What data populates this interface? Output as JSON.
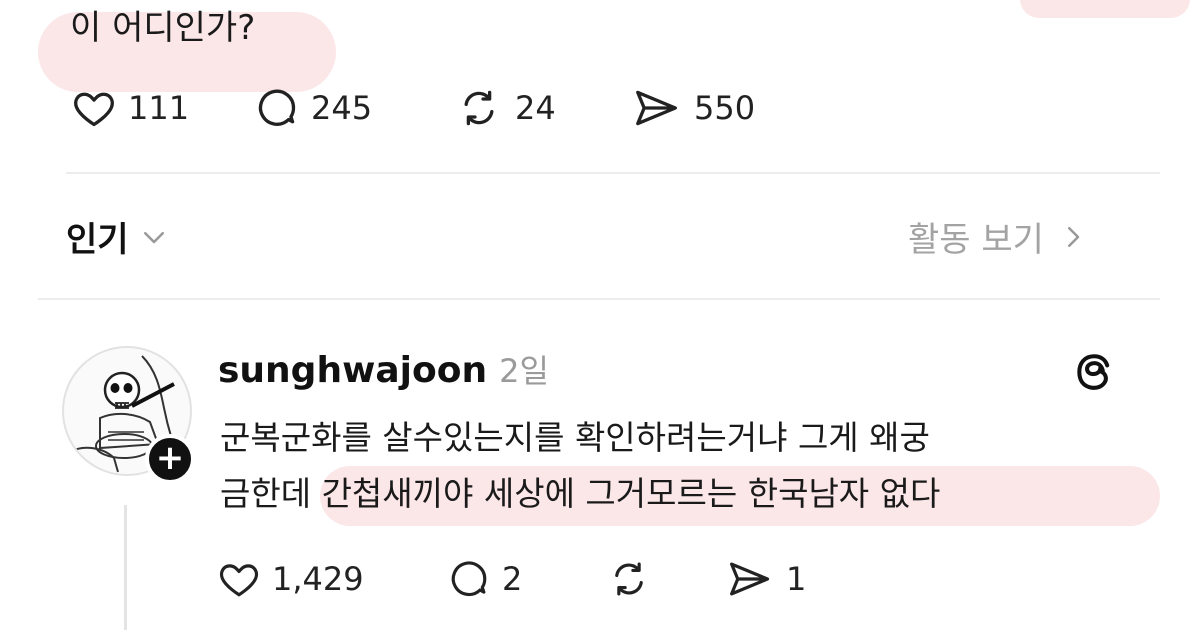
{
  "post": {
    "text_fragment": "이 어디인가?",
    "likes": "111",
    "replies": "245",
    "reposts": "24",
    "shares": "550"
  },
  "sort_bar": {
    "sort_label": "인기",
    "activity_label": "활동 보기"
  },
  "comment": {
    "username": "sunghwajoon",
    "time": "2일",
    "text_line1": "군복군화를 살수있는지를 확인하려는거냐  그게 왜궁",
    "text_line2": "금한데 간첩새끼야 세상에 그거모르는 한국남자 없다",
    "likes": "1,429",
    "replies": "2",
    "reposts": "",
    "shares": "1",
    "add_label": "+"
  },
  "colors": {
    "highlight": "#fbe3e6",
    "text": "#111111",
    "muted": "#a3a3a3"
  },
  "icons": [
    "heart-icon",
    "comment-icon",
    "repost-icon",
    "share-icon",
    "chevron-down-icon",
    "chevron-right-icon",
    "threads-icon"
  ]
}
